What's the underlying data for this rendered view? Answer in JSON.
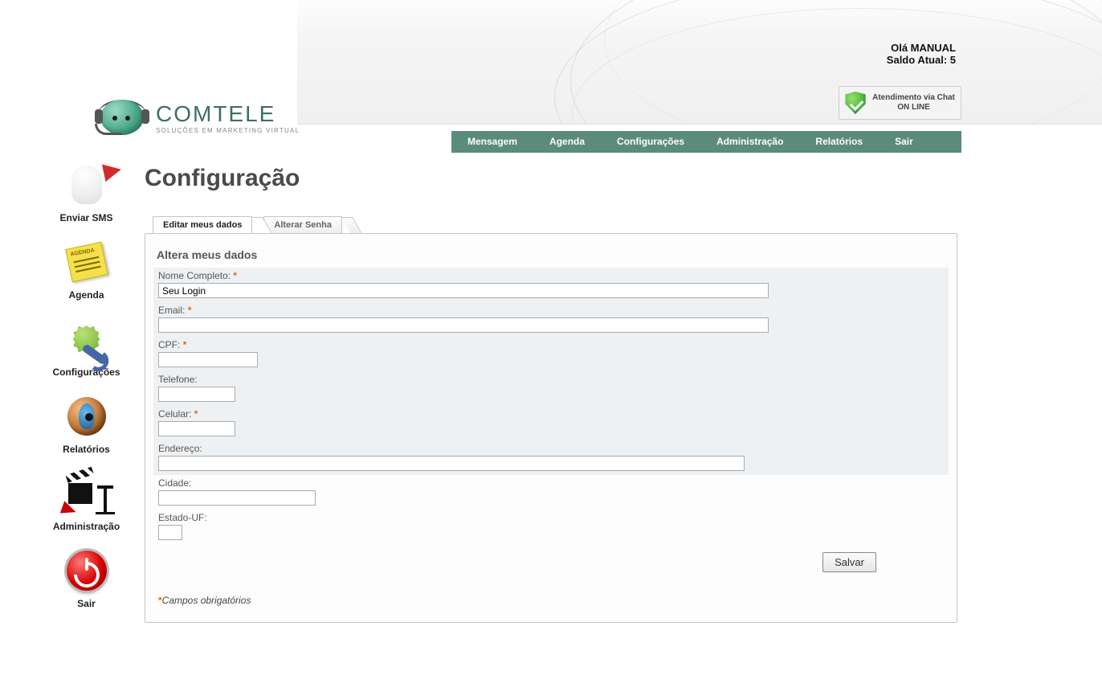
{
  "header": {
    "greeting": "Olá MANUAL",
    "balance_label": "Saldo Atual: 5",
    "chat_line1": "Atendimento via Chat",
    "chat_line2": "ON LINE"
  },
  "brand": {
    "name": "COMTELE",
    "tagline": "SOLUÇÕES EM MARKETING VIRTUAL"
  },
  "topnav": {
    "items": [
      "Mensagem",
      "Agenda",
      "Configurações",
      "Administração",
      "Relatórios",
      "Sair"
    ]
  },
  "sidebar": {
    "items": [
      {
        "label": "Enviar SMS"
      },
      {
        "label": "Agenda"
      },
      {
        "label": "Configurações"
      },
      {
        "label": "Relatórios"
      },
      {
        "label": "Administração"
      },
      {
        "label": "Sair"
      }
    ]
  },
  "page": {
    "title": "Configuração",
    "tabs": {
      "edit": "Editar meus dados",
      "password": "Alterar Senha"
    },
    "section": "Altera meus dados",
    "required_mark": "*",
    "fields": {
      "nome_label": "Nome Completo:",
      "nome_value": "Seu Login",
      "email_label": "Email:",
      "email_value": "",
      "cpf_label": "CPF:",
      "cpf_value": "",
      "telefone_label": "Telefone:",
      "telefone_value": "",
      "celular_label": "Celular:",
      "celular_value": "",
      "endereco_label": "Endereço:",
      "endereco_value": "",
      "cidade_label": "Cidade:",
      "cidade_value": "",
      "estado_label": "Estado-UF:",
      "estado_value": ""
    },
    "save_label": "Salvar",
    "footnote": "Campos obrigatórios"
  }
}
